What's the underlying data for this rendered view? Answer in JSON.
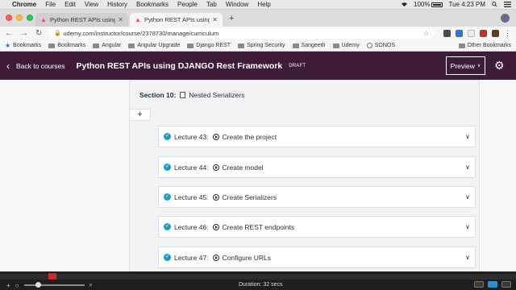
{
  "menubar": {
    "apple_icon": "apple-logo-icon",
    "items": [
      "Chrome",
      "File",
      "Edit",
      "View",
      "History",
      "Bookmarks",
      "People",
      "Tab",
      "Window",
      "Help"
    ],
    "battery": "100%",
    "clock": "Tue 4:23 PM"
  },
  "tabs": [
    {
      "title": "Python REST APIs using DJANGO",
      "favicon": "udemy-icon",
      "active": false
    },
    {
      "title": "Python REST APIs using DJANGO",
      "favicon": "udemy-icon",
      "active": true
    }
  ],
  "address": {
    "url": "udemy.com/instructor/course/2378730/manage/curriculum"
  },
  "bookmarks": {
    "items": [
      "Bookmarks",
      "Bookmarks",
      "Angular",
      "Angular Upgrade",
      "Django REST",
      "Spring Security",
      "Sangeeth",
      "Udemy",
      "SONOS"
    ],
    "other": "Other Bookmarks"
  },
  "header": {
    "back_label": "Back to courses",
    "course_title": "Python REST APIs using DJANGO Rest Framework",
    "status": "DRAFT",
    "preview_label": "Preview",
    "brand_color": "#3d1b39"
  },
  "section": {
    "label": "Section 10:",
    "title": "Nested Serializers"
  },
  "add_button": "+",
  "lectures": [
    {
      "label": "Lecture 43:",
      "title": "Create the project"
    },
    {
      "label": "Lecture 44:",
      "title": "Create model"
    },
    {
      "label": "Lecture 45:",
      "title": "Create Serializers"
    },
    {
      "label": "Lecture 46:",
      "title": "Create REST endpoints"
    },
    {
      "label": "Lecture 47:",
      "title": "Configure URLs"
    }
  ],
  "recorder": {
    "duration": "Duration: 32 secs"
  }
}
